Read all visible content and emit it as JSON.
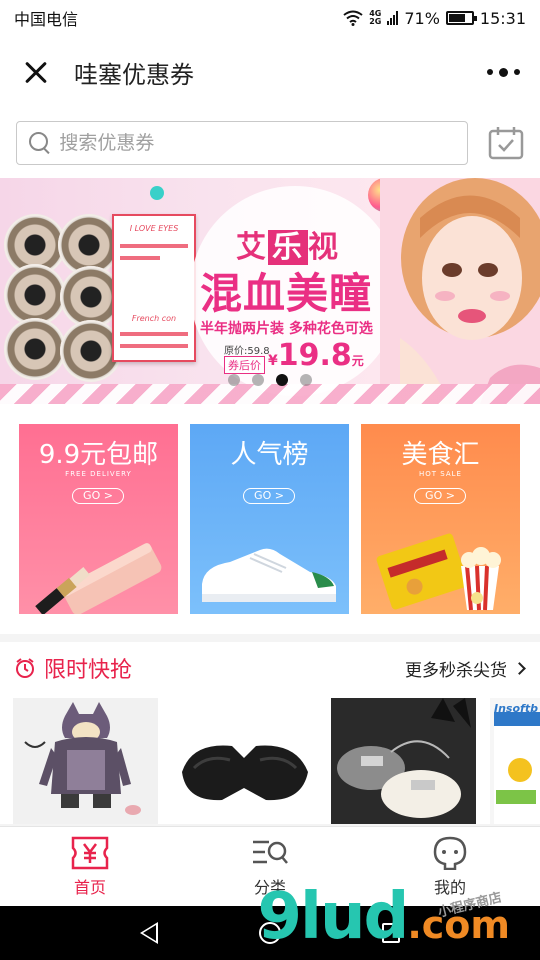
{
  "status_bar": {
    "carrier": "中国电信",
    "network": "4G",
    "network2": "2G",
    "battery_percent": "71%",
    "battery_level": 0.71,
    "time": "15:31"
  },
  "header": {
    "title": "哇塞优惠券"
  },
  "search": {
    "placeholder": "搜索优惠券"
  },
  "banner": {
    "brand_pre": "艾",
    "brand_hi": "乐",
    "brand_post": "视",
    "headline": "混血美瞳",
    "subline": "半年抛两片装 多种花色可选",
    "original_price": "原价:59.8",
    "coupon_tag": "券后价",
    "price_symbol": "¥",
    "price": "19.8",
    "price_unit": "元",
    "leaflet_title": "I LOVE EYES",
    "leaflet_sub": "French con",
    "slide_count": 4,
    "active_slide": 3
  },
  "categories": [
    {
      "title": "9.9元包邮",
      "subtitle": "FREE DELIVERY",
      "go": "GO >",
      "color": "#ff7b98"
    },
    {
      "title": "人气榜",
      "subtitle": "",
      "go": "GO >",
      "color": "#6ab3f7"
    },
    {
      "title": "美食汇",
      "subtitle": "HOT SALE",
      "go": "GO >",
      "color": "#ff9a5a"
    }
  ],
  "flash_sale": {
    "title": "限时快抢",
    "more": "更多秒杀尖货",
    "products": [
      {
        "name": "kids-winter-coat"
      },
      {
        "name": "sleep-eye-mask"
      },
      {
        "name": "fur-handbag"
      },
      {
        "name": "baby-diapers",
        "brand_text": "Insoftb"
      }
    ]
  },
  "tabbar": {
    "items": [
      {
        "label": "首页",
        "active": true
      },
      {
        "label": "分类",
        "active": false
      },
      {
        "label": "我的",
        "active": false
      }
    ]
  },
  "watermark": {
    "main": "9lud",
    "com": ".com",
    "small": "小程序商店"
  },
  "colors": {
    "accent": "#e8234c",
    "banner_pink": "#ea2f84"
  }
}
